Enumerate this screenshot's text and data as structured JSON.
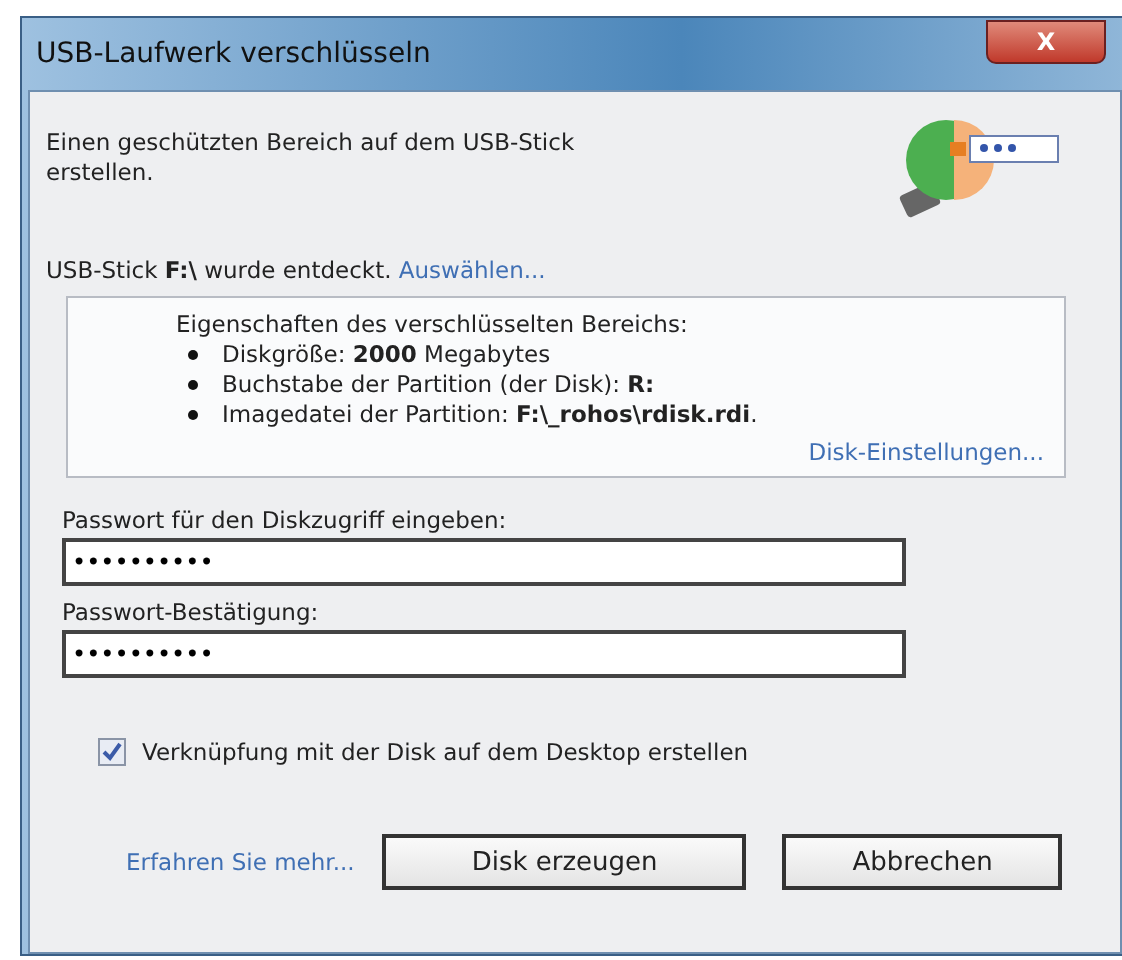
{
  "window": {
    "title": "USB-Laufwerk verschlüsseln",
    "close_label": "X"
  },
  "intro": "Einen geschützten Bereich auf dem USB-Stick erstellen.",
  "detected": {
    "text": "USB-Stick **F:\\** wurde entdeckt.",
    "link": "Auswählen..."
  },
  "properties": {
    "title": "Eigenschaften des verschlüsselten Bereichs:",
    "items": [
      "Diskgröße: **2000** Megabytes",
      "Buchstabe der Partition (der Disk): **R:**",
      "Imagedatei der Partition: **F:\\_rohos\\rdisk.rdi**."
    ],
    "link": "Disk-Einstellungen..."
  },
  "password": {
    "label": "Passwort für den Diskzugriff eingeben:",
    "value": "••••••••••"
  },
  "confirm": {
    "label": "Passwort-Bestätigung:",
    "value": "••••••••••"
  },
  "shortcut": {
    "label": "Verknüpfung mit der Disk auf dem Desktop erstellen",
    "checked": true
  },
  "footer": {
    "link": "Erfahren Sie mehr...",
    "buttons": [
      "Disk erzeugen",
      "Abbrechen"
    ]
  }
}
